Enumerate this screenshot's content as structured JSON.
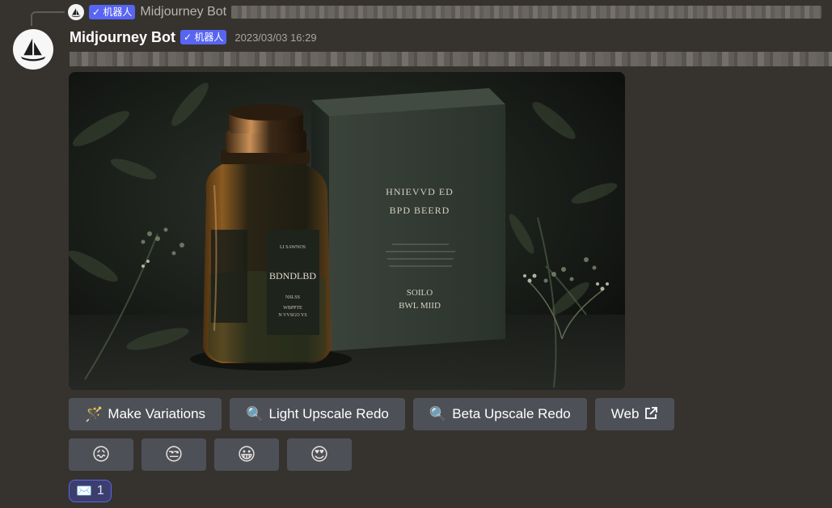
{
  "reply": {
    "bot_badge": "✓ 机器人",
    "author": "Midjourney Bot"
  },
  "message": {
    "author": "Midjourney Bot",
    "bot_badge": "✓ 机器人",
    "timestamp": "2023/03/03 16:29"
  },
  "artwork": {
    "bottle_label": "BDNDLBD",
    "bottle_small_top": "LI SAWNOS",
    "bottle_small_1": "NSLSS",
    "bottle_small_2": "WBPPTE",
    "bottle_small_3": "N VVSGO YS",
    "box_title_1": "HNIEVVD ED",
    "box_title_2": "BPD BEERD",
    "box_bottom_1": "SOILO",
    "box_bottom_2": "BWL MIID"
  },
  "buttons": [
    {
      "icon": "🪄",
      "label": "Make Variations"
    },
    {
      "icon": "🔍",
      "label": "Light Upscale Redo"
    },
    {
      "icon": "🔍",
      "label": "Beta Upscale Redo"
    },
    {
      "icon": "↗",
      "label": "Web"
    }
  ],
  "rating_emojis": [
    "😖",
    "😒",
    "😀",
    "😍"
  ],
  "reaction": {
    "emoji": "✉️",
    "count": "1"
  },
  "colors": {
    "background": "#36332f",
    "button": "#4e5058",
    "badge": "#5865f2",
    "reaction_border": "#5865f2"
  }
}
